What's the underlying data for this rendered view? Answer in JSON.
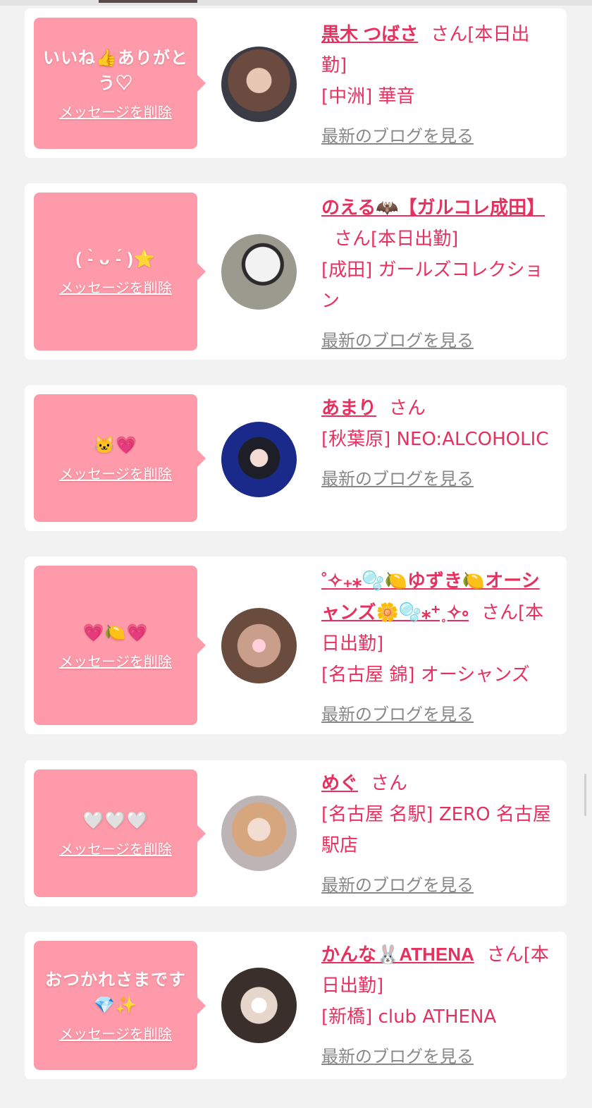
{
  "colors": {
    "accent": "#e8305f",
    "bubble": "#fe9aa9",
    "page_bg": "#f2f2f2",
    "blog_link": "#888888"
  },
  "delete_label": "メッセージを削除",
  "blog_label": "最新のブログを見る",
  "messages": [
    {
      "message": "いいね👍ありがとう♡",
      "name": "黒木 つばさ",
      "suffix": "さん[本日出勤]",
      "shop": "[中洲] 華音"
    },
    {
      "message": "( -̀ ᴗ -́ )⭐",
      "name": "のえる🦇【ガルコレ成田】",
      "suffix": "さん[本日出勤]",
      "shop": "[成田] ガールズコレクション"
    },
    {
      "message": "🐱💗",
      "name": "あまり",
      "suffix": "さん",
      "shop": "[秋葉原] NEO:ALCOHOLIC"
    },
    {
      "message": "💗🍋💗",
      "name": "˚✧₊⁎🫧🍋ゆずき🍋オーシャンズ🌼🫧⁎⁺˳✧༚",
      "suffix": "さん[本日出勤]",
      "shop": "[名古屋 錦] オーシャンズ"
    },
    {
      "message": "🤍🤍🤍",
      "name": "めぐ",
      "suffix": "さん",
      "shop": "[名古屋 名駅] ZERO 名古屋駅店"
    },
    {
      "message": "おつかれさまです💎✨",
      "name": "かんな🐰ATHENA",
      "suffix": "さん[本日出勤]",
      "shop": "[新橋] club ATHENA"
    }
  ]
}
